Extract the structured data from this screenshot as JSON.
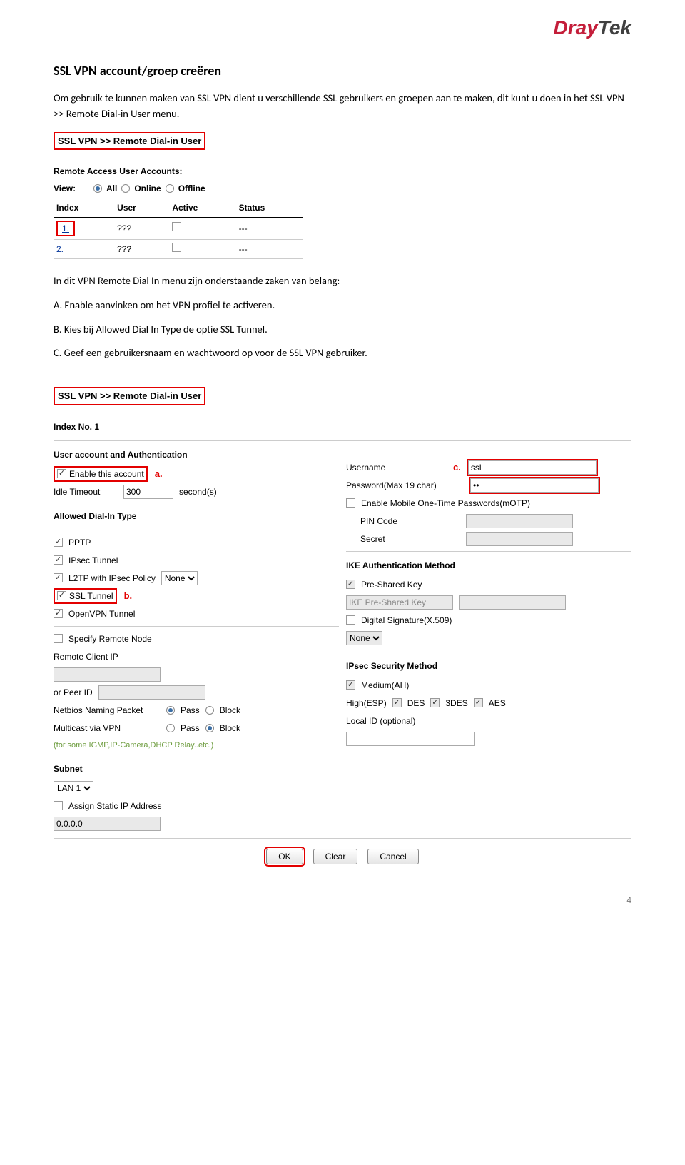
{
  "logo": {
    "part1": "Dray",
    "part2": "Tek"
  },
  "title": "SSL VPN account/groep creëren",
  "intro": "Om gebruik te kunnen maken van SSL VPN dient u verschillende SSL gebruikers en groepen aan te maken, dit kunt u doen in het SSL VPN >> Remote Dial-in User menu.",
  "shot1": {
    "breadcrumb": "SSL VPN >> Remote Dial-in User",
    "subhead": "Remote Access User Accounts:",
    "view_label": "View:",
    "view_options": [
      "All",
      "Online",
      "Offline"
    ],
    "table": {
      "headers": [
        "Index",
        "User",
        "Active",
        "Status"
      ],
      "rows": [
        {
          "index": "1.",
          "user": "???",
          "status": "---"
        },
        {
          "index": "2.",
          "user": "???",
          "status": "---"
        }
      ]
    }
  },
  "mid": {
    "lead": "In dit VPN Remote Dial In menu zijn onderstaande zaken van belang:",
    "a": "A. Enable aanvinken om het VPN profiel te activeren.",
    "b": "B. Kies bij Allowed Dial In Type de optie SSL Tunnel.",
    "c": "C. Geef een gebruikersnaam en wachtwoord op voor de SSL VPN gebruiker."
  },
  "shot2": {
    "breadcrumb": "SSL VPN >> Remote Dial-in User",
    "index": "Index No. 1",
    "left": {
      "useracct": "User account and Authentication",
      "enable": "Enable this account",
      "idle": "Idle Timeout",
      "idle_val": "300",
      "idle_unit": "second(s)",
      "dialin": "Allowed Dial-In Type",
      "pptp": "PPTP",
      "ipsec": "IPsec Tunnel",
      "l2tp": "L2TP with IPsec Policy",
      "l2tp_sel": "None",
      "ssl": "SSL Tunnel",
      "ovpn": "OpenVPN Tunnel",
      "specremote": "Specify Remote Node",
      "remoteip": "Remote Client IP",
      "peerid": "or Peer ID",
      "netbios": "Netbios Naming Packet",
      "multicast": "Multicast via VPN",
      "pass": "Pass",
      "block": "Block",
      "note": "(for some IGMP,IP-Camera,DHCP Relay..etc.)",
      "subnet": "Subnet",
      "subnet_sel": "LAN 1",
      "assign": "Assign Static IP Address",
      "static_ip": "0.0.0.0"
    },
    "right": {
      "user": "Username",
      "user_val": "ssl",
      "pass": "Password(Max 19 char)",
      "pass_val": "••",
      "motp": "Enable Mobile One-Time Passwords(mOTP)",
      "pin": "PIN Code",
      "secret": "Secret",
      "ike": "IKE Authentication Method",
      "psk": "Pre-Shared Key",
      "psk_ph": "IKE Pre-Shared Key",
      "dsig": "Digital Signature(X.509)",
      "dsig_sel": "None",
      "ipsecm": "IPsec Security Method",
      "med": "Medium(AH)",
      "high": "High(ESP)",
      "des": "DES",
      "tdes": "3DES",
      "aes": "AES",
      "localid": "Local ID (optional)"
    },
    "buttons": {
      "ok": "OK",
      "clear": "Clear",
      "cancel": "Cancel"
    },
    "ann": {
      "a": "a.",
      "b": "b.",
      "c": "c."
    }
  },
  "page_no": "4"
}
